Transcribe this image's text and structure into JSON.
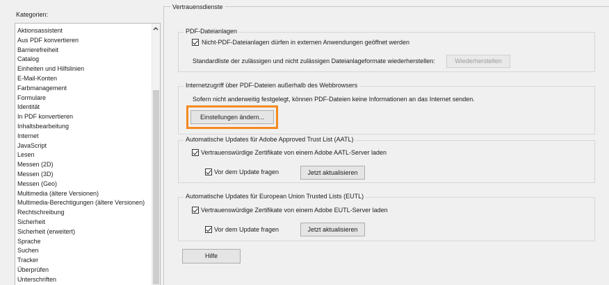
{
  "categories": {
    "label": "Kategorien:",
    "items": [
      "Aktionsassistent",
      "Aus PDF konvertieren",
      "Barrierefreiheit",
      "Catalog",
      "Einheiten und Hilfslinien",
      "E-Mail-Konten",
      "Farbmanagement",
      "Formulare",
      "Identität",
      "In PDF konvertieren",
      "Inhaltsbearbeitung",
      "Internet",
      "JavaScript",
      "Lesen",
      "Messen (2D)",
      "Messen (3D)",
      "Messen (Geo)",
      "Multimedia (ältere Versionen)",
      "Multimedia-Berechtigungen (ältere Versionen)",
      "Rechtschreibung",
      "Sicherheit",
      "Sicherheit (erweitert)",
      "Sprache",
      "Suchen",
      "Tracker",
      "Überprüfen",
      "Unterschriften"
    ]
  },
  "main": {
    "title": "Vertrauensdienste",
    "pdf_attachments": {
      "title": "PDF-Dateianlagen",
      "allow_label": "Nicht-PDF-Dateianlagen dürfen in externen Anwendungen geöffnet werden",
      "restore_text": "Standardliste der zulässigen und nicht zulässigen Dateianlageformate wiederherstellen:",
      "restore_button": "Wiederherstellen"
    },
    "internet_access": {
      "title": "Internetzugriff über PDF-Dateien außerhalb des Webbrowsers",
      "description": "Sofern nicht anderweitig festgelegt, können PDF-Dateien keine Informationen an das Internet senden.",
      "change_button": "Einstellungen ändern..."
    },
    "aatl": {
      "title": "Automatische Updates für Adobe Approved Trust List (AATL)",
      "load_label": "Vertrauenswürdige Zertifikate von einem Adobe AATL-Server laden",
      "ask_label": "Vor dem Update fragen",
      "update_button": "Jetzt aktualisieren"
    },
    "eutl": {
      "title": "Automatische Updates für European Union Trusted Lists (EUTL)",
      "load_label": "Vertrauenswürdige Zertifikate von einem Adobe EUTL-Server laden",
      "ask_label": "Vor dem Update fragen",
      "update_button": "Jetzt aktualisieren"
    },
    "help_button": "Hilfe"
  },
  "colors": {
    "highlight": "#f58a1f",
    "background": "#f0f0f0"
  }
}
